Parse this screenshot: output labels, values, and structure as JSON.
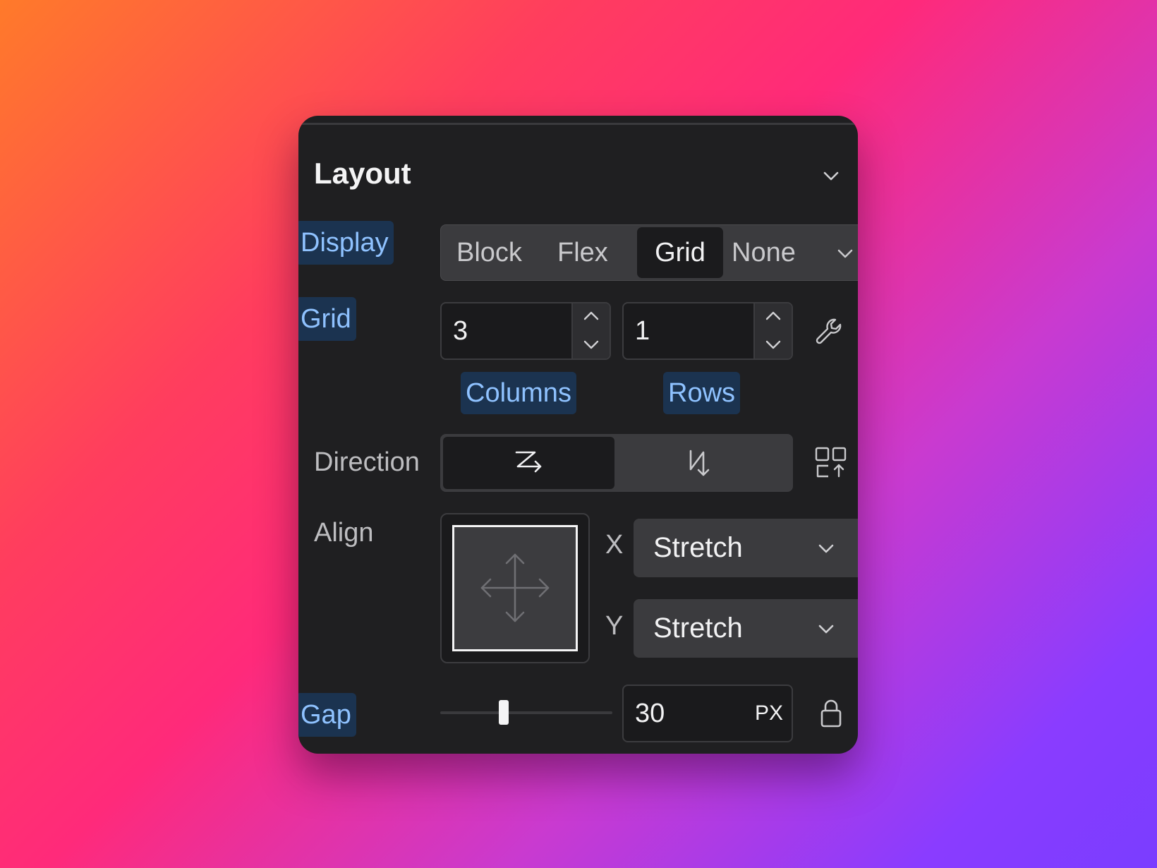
{
  "panel": {
    "title": "Layout"
  },
  "display": {
    "label": "Display",
    "options": [
      "Block",
      "Flex",
      "Grid",
      "None"
    ],
    "selected": "Grid"
  },
  "grid": {
    "label": "Grid",
    "columns_value": "3",
    "rows_value": "1",
    "columns_label": "Columns",
    "rows_label": "Rows"
  },
  "direction": {
    "label": "Direction",
    "selected": "row"
  },
  "align": {
    "label": "Align",
    "x_axis": "X",
    "y_axis": "Y",
    "x_value": "Stretch",
    "y_value": "Stretch"
  },
  "gap": {
    "label": "Gap",
    "value": "30",
    "unit": "PX",
    "slider_fraction": 0.37
  },
  "icons": [
    "chevron-down-icon",
    "chevron-up-icon",
    "wrench-icon",
    "direction-row-icon",
    "direction-column-icon",
    "auto-flow-icon",
    "move-arrows-icon",
    "lock-icon"
  ],
  "colors": {
    "panel_bg": "#1f1f21",
    "tag_bg": "#1b3350",
    "tag_text": "#8fc2ff",
    "active_bg": "#1b1b1d",
    "control_bg": "#3b3b3e"
  }
}
